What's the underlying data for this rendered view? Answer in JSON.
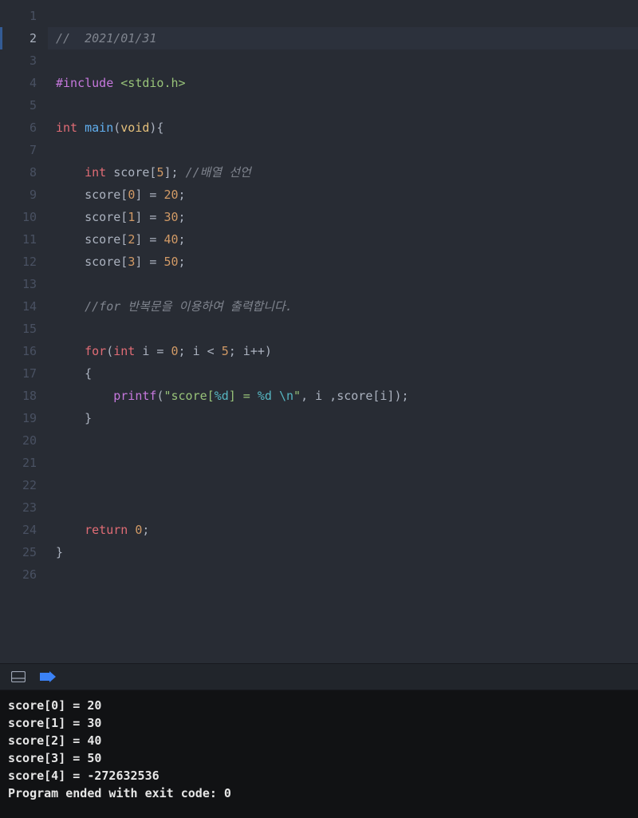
{
  "editor": {
    "activeLine": 2,
    "lines": [
      {
        "n": 1,
        "tokens": []
      },
      {
        "n": 2,
        "tokens": [
          {
            "t": "//  2021/01/31",
            "c": "comment"
          }
        ]
      },
      {
        "n": 3,
        "tokens": []
      },
      {
        "n": 4,
        "tokens": [
          {
            "t": "#include",
            "c": "preproc"
          },
          {
            "t": " ",
            "c": ""
          },
          {
            "t": "<stdio.h>",
            "c": "angle-include"
          }
        ]
      },
      {
        "n": 5,
        "tokens": []
      },
      {
        "n": 6,
        "tokens": [
          {
            "t": "int",
            "c": "intkw"
          },
          {
            "t": " ",
            "c": ""
          },
          {
            "t": "main",
            "c": "func"
          },
          {
            "t": "(",
            "c": "punct"
          },
          {
            "t": "void",
            "c": "voidkw"
          },
          {
            "t": "){",
            "c": "punct"
          }
        ]
      },
      {
        "n": 7,
        "tokens": []
      },
      {
        "n": 8,
        "tokens": [
          {
            "t": "    ",
            "c": ""
          },
          {
            "t": "int",
            "c": "intkw"
          },
          {
            "t": " score[",
            "c": "ident"
          },
          {
            "t": "5",
            "c": "num"
          },
          {
            "t": "]; ",
            "c": "ident"
          },
          {
            "t": "//배열 선언",
            "c": "comment"
          }
        ]
      },
      {
        "n": 9,
        "tokens": [
          {
            "t": "    score[",
            "c": "ident"
          },
          {
            "t": "0",
            "c": "num"
          },
          {
            "t": "] = ",
            "c": "ident"
          },
          {
            "t": "20",
            "c": "num"
          },
          {
            "t": ";",
            "c": "ident"
          }
        ]
      },
      {
        "n": 10,
        "tokens": [
          {
            "t": "    score[",
            "c": "ident"
          },
          {
            "t": "1",
            "c": "num"
          },
          {
            "t": "] = ",
            "c": "ident"
          },
          {
            "t": "30",
            "c": "num"
          },
          {
            "t": ";",
            "c": "ident"
          }
        ]
      },
      {
        "n": 11,
        "tokens": [
          {
            "t": "    score[",
            "c": "ident"
          },
          {
            "t": "2",
            "c": "num"
          },
          {
            "t": "] = ",
            "c": "ident"
          },
          {
            "t": "40",
            "c": "num"
          },
          {
            "t": ";",
            "c": "ident"
          }
        ]
      },
      {
        "n": 12,
        "tokens": [
          {
            "t": "    score[",
            "c": "ident"
          },
          {
            "t": "3",
            "c": "num"
          },
          {
            "t": "] = ",
            "c": "ident"
          },
          {
            "t": "50",
            "c": "num"
          },
          {
            "t": ";",
            "c": "ident"
          }
        ]
      },
      {
        "n": 13,
        "tokens": []
      },
      {
        "n": 14,
        "tokens": [
          {
            "t": "    ",
            "c": ""
          },
          {
            "t": "//for 반복문을 이용하여 출력합니다.",
            "c": "comment"
          }
        ]
      },
      {
        "n": 15,
        "tokens": []
      },
      {
        "n": 16,
        "tokens": [
          {
            "t": "    ",
            "c": ""
          },
          {
            "t": "for",
            "c": "redkw"
          },
          {
            "t": "(",
            "c": "punct"
          },
          {
            "t": "int",
            "c": "intkw"
          },
          {
            "t": " i = ",
            "c": "ident"
          },
          {
            "t": "0",
            "c": "num"
          },
          {
            "t": "; i < ",
            "c": "ident"
          },
          {
            "t": "5",
            "c": "num"
          },
          {
            "t": "; i++)",
            "c": "ident"
          }
        ]
      },
      {
        "n": 17,
        "tokens": [
          {
            "t": "    {",
            "c": "ident"
          }
        ]
      },
      {
        "n": 18,
        "tokens": [
          {
            "t": "        ",
            "c": ""
          },
          {
            "t": "printf",
            "c": "callfn"
          },
          {
            "t": "(",
            "c": "punct"
          },
          {
            "t": "\"score[",
            "c": "str"
          },
          {
            "t": "%d",
            "c": "esc"
          },
          {
            "t": "] = ",
            "c": "str"
          },
          {
            "t": "%d",
            "c": "esc"
          },
          {
            "t": " ",
            "c": "str"
          },
          {
            "t": "\\n",
            "c": "esc"
          },
          {
            "t": "\"",
            "c": "str"
          },
          {
            "t": ", i ,score[i]);",
            "c": "ident"
          }
        ]
      },
      {
        "n": 19,
        "tokens": [
          {
            "t": "    }",
            "c": "ident"
          }
        ]
      },
      {
        "n": 20,
        "tokens": []
      },
      {
        "n": 21,
        "tokens": []
      },
      {
        "n": 22,
        "tokens": []
      },
      {
        "n": 23,
        "tokens": []
      },
      {
        "n": 24,
        "tokens": [
          {
            "t": "    ",
            "c": ""
          },
          {
            "t": "return",
            "c": "redkw"
          },
          {
            "t": " ",
            "c": ""
          },
          {
            "t": "0",
            "c": "num"
          },
          {
            "t": ";",
            "c": "ident"
          }
        ]
      },
      {
        "n": 25,
        "tokens": [
          {
            "t": "}",
            "c": "ident"
          }
        ]
      },
      {
        "n": 26,
        "tokens": []
      }
    ]
  },
  "console": {
    "lines": [
      "score[0] = 20 ",
      "score[1] = 30 ",
      "score[2] = 40 ",
      "score[3] = 50 ",
      "score[4] = -272632536 ",
      "Program ended with exit code: 0"
    ]
  }
}
